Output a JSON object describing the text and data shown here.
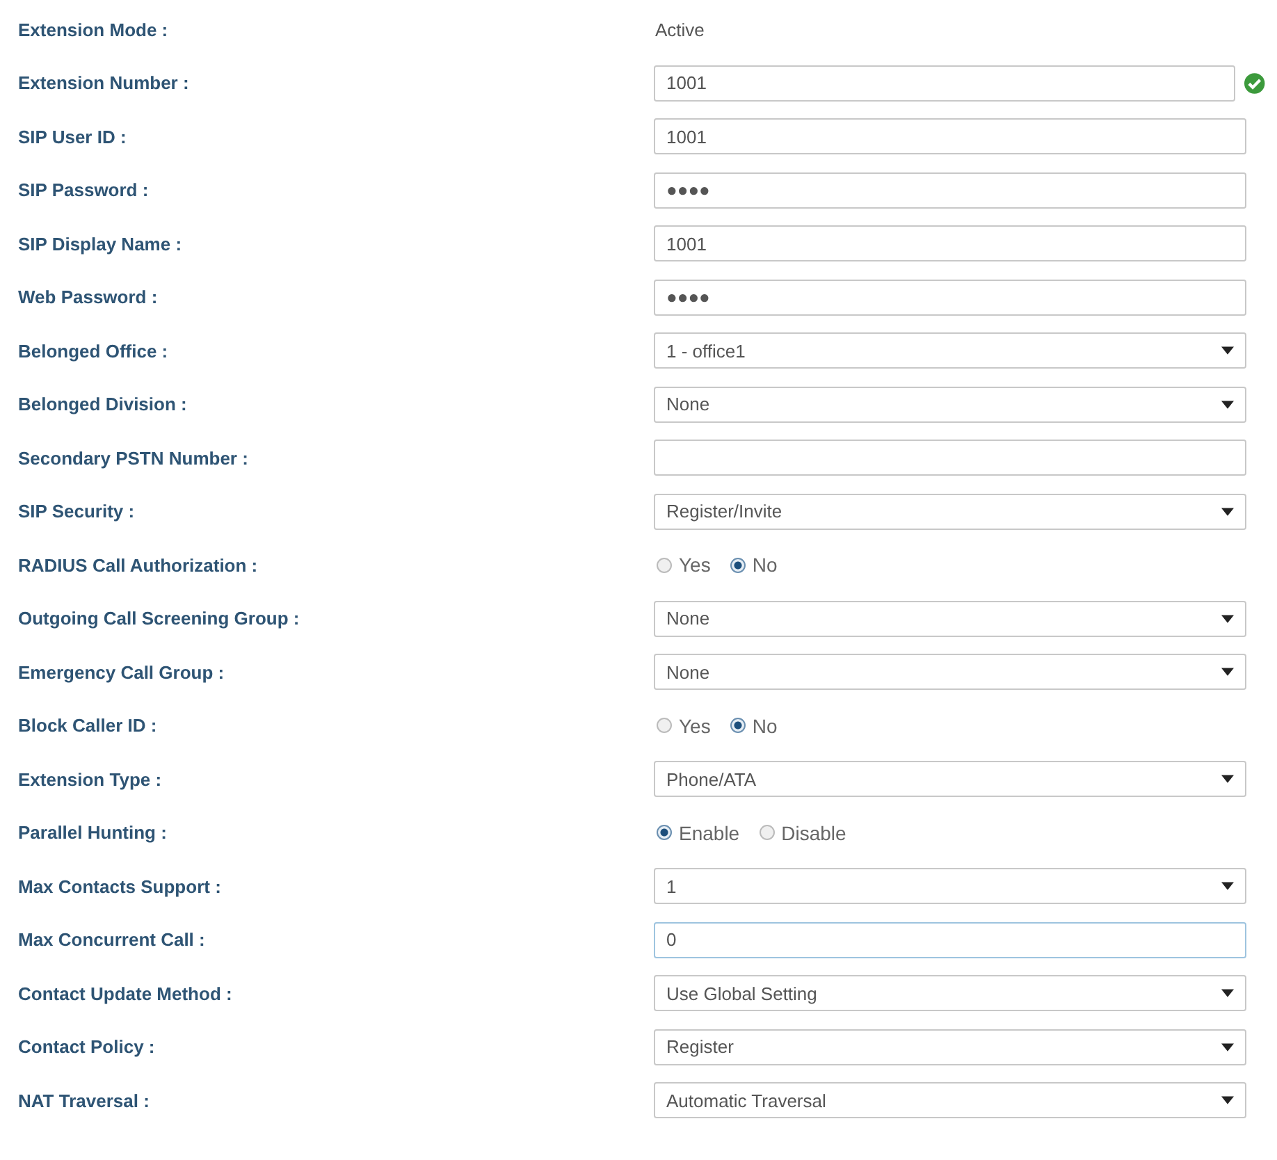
{
  "rows": [
    {
      "label": "Extension Mode :",
      "kind": "text",
      "value": "Active"
    },
    {
      "label": "Extension Number :",
      "kind": "field",
      "value": "1001",
      "valid": true
    },
    {
      "label": "SIP User ID :",
      "kind": "field",
      "value": "1001"
    },
    {
      "label": "SIP Password :",
      "kind": "field",
      "value": "●●●●"
    },
    {
      "label": "SIP Display Name :",
      "kind": "field",
      "value": "1001"
    },
    {
      "label": "Web Password :",
      "kind": "field",
      "value": "●●●●"
    },
    {
      "label": "Belonged Office :",
      "kind": "select",
      "value": "1 - office1"
    },
    {
      "label": "Belonged Division :",
      "kind": "select",
      "value": "None"
    },
    {
      "label": "Secondary PSTN Number :",
      "kind": "field",
      "value": ""
    },
    {
      "label": "SIP Security :",
      "kind": "select",
      "value": "Register/Invite"
    },
    {
      "label": "RADIUS Call Authorization :",
      "kind": "radio",
      "options": [
        {
          "label": "Yes",
          "selected": false
        },
        {
          "label": "No",
          "selected": true
        }
      ]
    },
    {
      "label": "Outgoing Call Screening Group :",
      "kind": "select",
      "value": "None"
    },
    {
      "label": "Emergency Call Group :",
      "kind": "select",
      "value": "None"
    },
    {
      "label": "Block Caller ID :",
      "kind": "radio",
      "options": [
        {
          "label": "Yes",
          "selected": false
        },
        {
          "label": "No",
          "selected": true
        }
      ]
    },
    {
      "label": "Extension Type :",
      "kind": "select",
      "value": "Phone/ATA"
    },
    {
      "label": "Parallel Hunting :",
      "kind": "radio",
      "options": [
        {
          "label": "Enable",
          "selected": true
        },
        {
          "label": "Disable",
          "selected": false
        }
      ]
    },
    {
      "label": "Max Contacts Support :",
      "kind": "select",
      "value": "1"
    },
    {
      "label": "Max Concurrent Call :",
      "kind": "field",
      "value": "0",
      "focused": true
    },
    {
      "label": "Contact Update Method :",
      "kind": "select",
      "value": "Use Global Setting"
    },
    {
      "label": "Contact Policy :",
      "kind": "select",
      "value": "Register"
    },
    {
      "label": "NAT Traversal :",
      "kind": "select",
      "value": "Automatic Traversal"
    }
  ]
}
